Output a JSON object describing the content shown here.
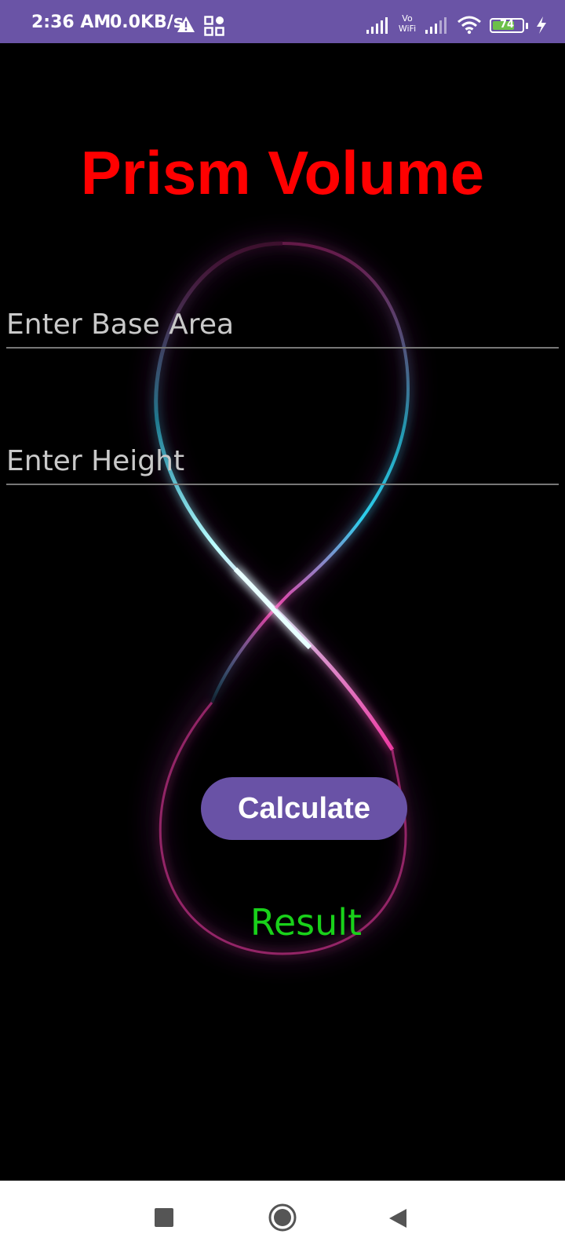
{
  "status_bar": {
    "time": "2:36 AM",
    "network_speed": "0.0KB/s",
    "battery_level": "74",
    "battery_fraction": 0.74,
    "icons": [
      "warning-icon",
      "qr-icon",
      "signal-icon",
      "vowifi-icon",
      "signal-icon",
      "wifi-icon",
      "battery-icon",
      "charging-bolt-icon"
    ],
    "vowifi_label_top": "Vo",
    "vowifi_label_bottom": "WiFi"
  },
  "app": {
    "title": "Prism Volume",
    "base_area_placeholder": "Enter Base Area",
    "base_area_value": "",
    "height_placeholder": "Enter Height",
    "height_value": "",
    "calculate_label": "Calculate",
    "result_label": "Result"
  },
  "nav_bar": {
    "icons": [
      "recents-square-icon",
      "home-circle-icon",
      "back-triangle-icon"
    ]
  },
  "colors": {
    "status_bar": "#6a54a6",
    "background": "#000000",
    "title": "#ff0000",
    "button": "#6952a6",
    "result": "#19d11a",
    "accent_cyan": "#2fe0ff",
    "accent_pink": "#ff3fae"
  }
}
